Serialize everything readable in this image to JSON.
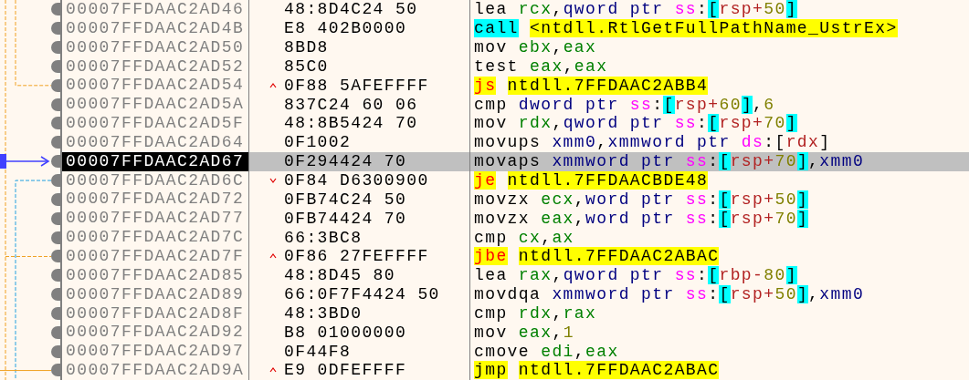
{
  "rows": [
    {
      "address": "00007FFDAAC2AD46",
      "bytes": "48:8D4C24 50",
      "kind": "plain",
      "selected": false,
      "asm": [
        {
          "text": "lea",
          "kind": "op"
        },
        {
          "text": "rcx",
          "kind": "reg"
        },
        {
          "text": ",",
          "kind": "punct"
        },
        {
          "text": "qword ptr ",
          "kind": "size"
        },
        {
          "text": "ss",
          "kind": "seg"
        },
        {
          "text": ":",
          "kind": "punct"
        },
        {
          "text": "[",
          "kind": "bracket"
        },
        {
          "text": "rsp+",
          "kind": "base"
        },
        {
          "text": "50",
          "kind": "num"
        },
        {
          "text": "]",
          "kind": "bracket"
        }
      ]
    },
    {
      "address": "00007FFDAAC2AD4B",
      "bytes": "E8 402B0000",
      "kind": "plain",
      "selected": false,
      "asm": [
        {
          "text": "call",
          "kind": "call"
        },
        {
          "text": "<ntdll.RtlGetFullPathName_UstrEx>",
          "kind": "target"
        }
      ]
    },
    {
      "address": "00007FFDAAC2AD50",
      "bytes": "8BD8",
      "kind": "plain",
      "selected": false,
      "asm": [
        {
          "text": "mov",
          "kind": "op"
        },
        {
          "text": "ebx",
          "kind": "reg"
        },
        {
          "text": ",",
          "kind": "punct"
        },
        {
          "text": "eax",
          "kind": "reg"
        }
      ]
    },
    {
      "address": "00007FFDAAC2AD52",
      "bytes": "85C0",
      "kind": "plain",
      "selected": false,
      "asm": [
        {
          "text": "test",
          "kind": "op"
        },
        {
          "text": "eax",
          "kind": "reg"
        },
        {
          "text": ",",
          "kind": "punct"
        },
        {
          "text": "eax",
          "kind": "reg"
        }
      ]
    },
    {
      "address": "00007FFDAAC2AD54",
      "bytes": "0F88 5AFEFFFF",
      "kind": "jump-up",
      "selected": false,
      "asm": [
        {
          "text": "js",
          "kind": "jcc"
        },
        {
          "text": "ntdll.7FFDAAC2ABB4",
          "kind": "target"
        }
      ]
    },
    {
      "address": "00007FFDAAC2AD5A",
      "bytes": "837C24 60 06",
      "kind": "plain",
      "selected": false,
      "asm": [
        {
          "text": "cmp",
          "kind": "op"
        },
        {
          "text": "dword ptr ",
          "kind": "size"
        },
        {
          "text": "ss",
          "kind": "seg"
        },
        {
          "text": ":",
          "kind": "punct"
        },
        {
          "text": "[",
          "kind": "bracket"
        },
        {
          "text": "rsp+",
          "kind": "base"
        },
        {
          "text": "60",
          "kind": "num"
        },
        {
          "text": "]",
          "kind": "bracket"
        },
        {
          "text": ",",
          "kind": "punct"
        },
        {
          "text": "6",
          "kind": "num"
        }
      ]
    },
    {
      "address": "00007FFDAAC2AD5F",
      "bytes": "48:8B5424 70",
      "kind": "plain",
      "selected": false,
      "asm": [
        {
          "text": "mov",
          "kind": "op"
        },
        {
          "text": "rdx",
          "kind": "reg"
        },
        {
          "text": ",",
          "kind": "punct"
        },
        {
          "text": "qword ptr ",
          "kind": "size"
        },
        {
          "text": "ss",
          "kind": "seg"
        },
        {
          "text": ":",
          "kind": "punct"
        },
        {
          "text": "[",
          "kind": "bracket"
        },
        {
          "text": "rsp+",
          "kind": "base"
        },
        {
          "text": "70",
          "kind": "num"
        },
        {
          "text": "]",
          "kind": "bracket"
        }
      ]
    },
    {
      "address": "00007FFDAAC2AD64",
      "bytes": "0F1002",
      "kind": "plain",
      "selected": false,
      "asm": [
        {
          "text": "movups",
          "kind": "op"
        },
        {
          "text": "xmm0",
          "kind": "xmm"
        },
        {
          "text": ",",
          "kind": "punct"
        },
        {
          "text": "xmmword ptr ",
          "kind": "size"
        },
        {
          "text": "ds",
          "kind": "seg"
        },
        {
          "text": ":",
          "kind": "punct"
        },
        {
          "text": "[",
          "kind": "pbracket"
        },
        {
          "text": "rdx",
          "kind": "base"
        },
        {
          "text": "]",
          "kind": "pbracket"
        }
      ]
    },
    {
      "address": "00007FFDAAC2AD67",
      "bytes": "0F294424 70",
      "kind": "plain",
      "selected": true,
      "asm": [
        {
          "text": "movaps",
          "kind": "op"
        },
        {
          "text": "xmmword ptr ",
          "kind": "size"
        },
        {
          "text": "ss",
          "kind": "seg"
        },
        {
          "text": ":",
          "kind": "punct"
        },
        {
          "text": "[",
          "kind": "bracket"
        },
        {
          "text": "rsp+",
          "kind": "base"
        },
        {
          "text": "70",
          "kind": "num"
        },
        {
          "text": "]",
          "kind": "bracket"
        },
        {
          "text": ",",
          "kind": "punct"
        },
        {
          "text": "xmm0",
          "kind": "xmm"
        }
      ]
    },
    {
      "address": "00007FFDAAC2AD6C",
      "bytes": "0F84 D6300900",
      "kind": "jump-down",
      "selected": false,
      "asm": [
        {
          "text": "je",
          "kind": "jcc"
        },
        {
          "text": "ntdll.7FFDAACBDE48",
          "kind": "target"
        }
      ]
    },
    {
      "address": "00007FFDAAC2AD72",
      "bytes": "0FB74C24 50",
      "kind": "plain",
      "selected": false,
      "asm": [
        {
          "text": "movzx",
          "kind": "op"
        },
        {
          "text": "ecx",
          "kind": "reg"
        },
        {
          "text": ",",
          "kind": "punct"
        },
        {
          "text": "word ptr ",
          "kind": "size"
        },
        {
          "text": "ss",
          "kind": "seg"
        },
        {
          "text": ":",
          "kind": "punct"
        },
        {
          "text": "[",
          "kind": "bracket"
        },
        {
          "text": "rsp+",
          "kind": "base"
        },
        {
          "text": "50",
          "kind": "num"
        },
        {
          "text": "]",
          "kind": "bracket"
        }
      ]
    },
    {
      "address": "00007FFDAAC2AD77",
      "bytes": "0FB74424 70",
      "kind": "plain",
      "selected": false,
      "asm": [
        {
          "text": "movzx",
          "kind": "op"
        },
        {
          "text": "eax",
          "kind": "reg"
        },
        {
          "text": ",",
          "kind": "punct"
        },
        {
          "text": "word ptr ",
          "kind": "size"
        },
        {
          "text": "ss",
          "kind": "seg"
        },
        {
          "text": ":",
          "kind": "punct"
        },
        {
          "text": "[",
          "kind": "bracket"
        },
        {
          "text": "rsp+",
          "kind": "base"
        },
        {
          "text": "70",
          "kind": "num"
        },
        {
          "text": "]",
          "kind": "bracket"
        }
      ]
    },
    {
      "address": "00007FFDAAC2AD7C",
      "bytes": "66:3BC8",
      "kind": "plain",
      "selected": false,
      "asm": [
        {
          "text": "cmp",
          "kind": "op"
        },
        {
          "text": "cx",
          "kind": "reg"
        },
        {
          "text": ",",
          "kind": "punct"
        },
        {
          "text": "ax",
          "kind": "reg"
        }
      ]
    },
    {
      "address": "00007FFDAAC2AD7F",
      "bytes": "0F86 27FEFFFF",
      "kind": "jump-up",
      "selected": false,
      "asm": [
        {
          "text": "jbe",
          "kind": "jcc"
        },
        {
          "text": "ntdll.7FFDAAC2ABAC",
          "kind": "target"
        }
      ]
    },
    {
      "address": "00007FFDAAC2AD85",
      "bytes": "48:8D45 80",
      "kind": "plain",
      "selected": false,
      "asm": [
        {
          "text": "lea",
          "kind": "op"
        },
        {
          "text": "rax",
          "kind": "reg"
        },
        {
          "text": ",",
          "kind": "punct"
        },
        {
          "text": "qword ptr ",
          "kind": "size"
        },
        {
          "text": "ss",
          "kind": "seg"
        },
        {
          "text": ":",
          "kind": "punct"
        },
        {
          "text": "[",
          "kind": "bracket"
        },
        {
          "text": "rbp-",
          "kind": "base"
        },
        {
          "text": "80",
          "kind": "num"
        },
        {
          "text": "]",
          "kind": "bracket"
        }
      ]
    },
    {
      "address": "00007FFDAAC2AD89",
      "bytes": "66:0F7F4424 50",
      "kind": "plain",
      "selected": false,
      "asm": [
        {
          "text": "movdqa",
          "kind": "op"
        },
        {
          "text": "xmmword ptr ",
          "kind": "size"
        },
        {
          "text": "ss",
          "kind": "seg"
        },
        {
          "text": ":",
          "kind": "punct"
        },
        {
          "text": "[",
          "kind": "bracket"
        },
        {
          "text": "rsp+",
          "kind": "base"
        },
        {
          "text": "50",
          "kind": "num"
        },
        {
          "text": "]",
          "kind": "bracket"
        },
        {
          "text": ",",
          "kind": "punct"
        },
        {
          "text": "xmm0",
          "kind": "xmm"
        }
      ]
    },
    {
      "address": "00007FFDAAC2AD8F",
      "bytes": "48:3BD0",
      "kind": "plain",
      "selected": false,
      "asm": [
        {
          "text": "cmp",
          "kind": "op"
        },
        {
          "text": "rdx",
          "kind": "reg"
        },
        {
          "text": ",",
          "kind": "punct"
        },
        {
          "text": "rax",
          "kind": "reg"
        }
      ]
    },
    {
      "address": "00007FFDAAC2AD92",
      "bytes": "B8 01000000",
      "kind": "plain",
      "selected": false,
      "asm": [
        {
          "text": "mov",
          "kind": "op"
        },
        {
          "text": "eax",
          "kind": "reg"
        },
        {
          "text": ",",
          "kind": "punct"
        },
        {
          "text": "1",
          "kind": "num"
        }
      ]
    },
    {
      "address": "00007FFDAAC2AD97",
      "bytes": "0F44F8",
      "kind": "plain",
      "selected": false,
      "asm": [
        {
          "text": "cmove",
          "kind": "op"
        },
        {
          "text": "edi",
          "kind": "reg"
        },
        {
          "text": ",",
          "kind": "punct"
        },
        {
          "text": "eax",
          "kind": "reg"
        }
      ]
    },
    {
      "address": "00007FFDAAC2AD9A",
      "bytes": "E9 0DFEFFFF",
      "kind": "jump-up",
      "selected": false,
      "asm": [
        {
          "text": "jmp",
          "kind": "jmp"
        },
        {
          "text": "ntdll.7FFDAAC2ABAC",
          "kind": "target"
        }
      ]
    }
  ]
}
